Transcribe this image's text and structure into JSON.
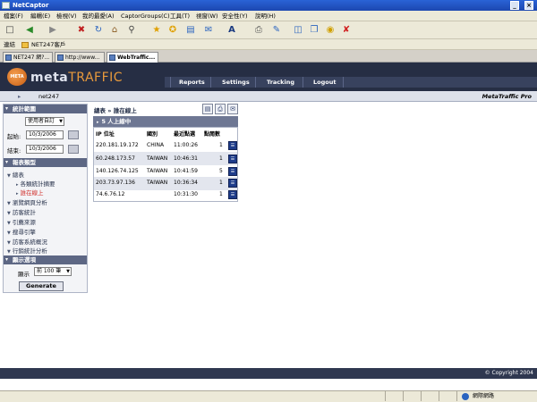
{
  "window": {
    "title": "NetCaptor",
    "controls": [
      "_",
      "□",
      "×"
    ]
  },
  "menu": [
    "檔案(F)",
    "編輯(E)",
    "檢視(V)",
    "我的最愛(A)",
    "CaptorGroups(C)",
    "工具(T)",
    "視窗(W)",
    "安全性(Y)",
    "說明(H)"
  ],
  "toolbar_icons": [
    "new-page-icon",
    "back-icon",
    "forward-icon",
    "stop-icon",
    "refresh-icon",
    "home-icon",
    "search-icon",
    "favorites-icon",
    "add-favorite-icon",
    "history-icon",
    "mail-icon",
    "font-size-icon",
    "print-icon",
    "edit-icon",
    "tile-icon",
    "cascade-icon",
    "lock-icon",
    "close-all-icon"
  ],
  "links": {
    "label": "連結",
    "item": "NET247客戶"
  },
  "tabs": [
    "NET247 網?...",
    "http://www...",
    "WebTraffic..."
  ],
  "app": {
    "logo_mark": "META",
    "logo_main": "meta",
    "logo_accent": "TRAFFIC",
    "nav": [
      "Reports",
      "Settings",
      "Tracking",
      "Logout"
    ],
    "site": "net247",
    "product": "MetaTraffic Pro"
  },
  "left": {
    "stats_header": "統計範圍",
    "range_select": "使用者自訂",
    "start_label": "起始:",
    "start_value": "10/3/2006",
    "end_label": "結束:",
    "end_value": "10/3/2006",
    "report_header": "報表類型",
    "tree": {
      "overview": "總表",
      "summary": "各類統計摘要",
      "online": "誰在線上",
      "browse": "瀏覽網頁分析",
      "visitors": "訪客統計",
      "referrers": "引薦來源",
      "search": "搜尋引擎",
      "system": "訪客系統概況",
      "ecommerce": "行銷統計分析"
    },
    "display_header": "顯示選項",
    "show_label": "顯示",
    "show_value": "前 100 筆",
    "generate": "Generate"
  },
  "main": {
    "breadcrumb": "總表 » 誰在線上",
    "action_icons": [
      "export-icon",
      "print-icon",
      "email-icon"
    ],
    "panel_title": "5 人上線中",
    "columns": [
      "IP 位址",
      "國別",
      "最近點選",
      "點閱數"
    ],
    "rows": [
      {
        "ip": "220.181.19.172",
        "country": "CHINA",
        "time": "11:00:26",
        "hits": "1"
      },
      {
        "ip": "60.248.173.57",
        "country": "TAIWAN",
        "time": "10:46:31",
        "hits": "1"
      },
      {
        "ip": "140.126.74.125",
        "country": "TAIWAN",
        "time": "10:41:59",
        "hits": "5"
      },
      {
        "ip": "203.73.97.136",
        "country": "TAIWAN",
        "time": "10:36:34",
        "hits": "1"
      },
      {
        "ip": "74.6.76.12",
        "country": "",
        "time": "10:31:30",
        "hits": "1"
      }
    ]
  },
  "footer": "© Copyright 2004",
  "status": {
    "zone": "網際網路"
  }
}
